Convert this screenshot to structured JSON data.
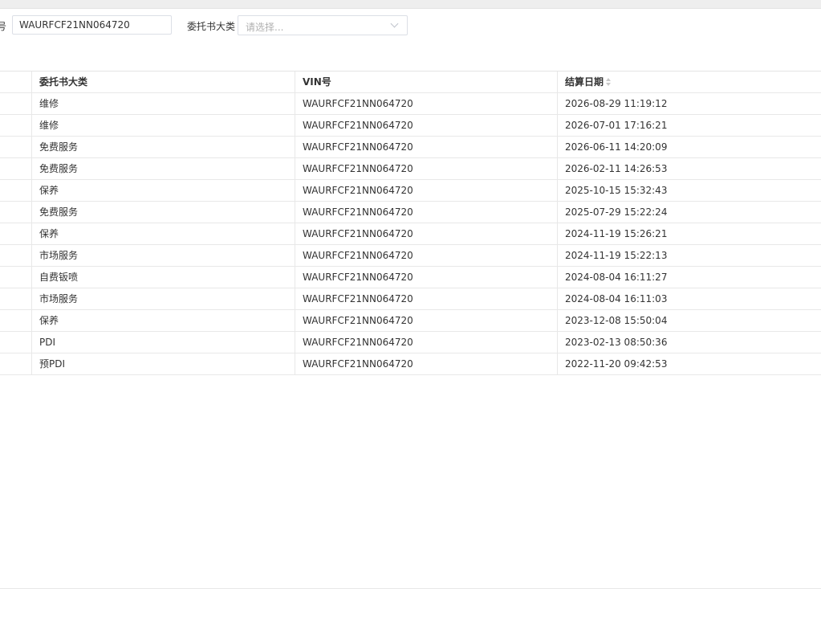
{
  "filters": {
    "vin_label": "号",
    "vin_value": "WAURFCF21NN064720",
    "category_label": "委托书大类",
    "category_placeholder": "请选择..."
  },
  "table": {
    "columns": [
      "",
      "委托书大类",
      "VIN号",
      "结算日期"
    ],
    "rows": [
      {
        "category": "维修",
        "vin": "WAURFCF21NN064720",
        "date": "2026-08-29 11:19:12"
      },
      {
        "category": "维修",
        "vin": "WAURFCF21NN064720",
        "date": "2026-07-01 17:16:21"
      },
      {
        "category": "免费服务",
        "vin": "WAURFCF21NN064720",
        "date": "2026-06-11 14:20:09"
      },
      {
        "category": "免费服务",
        "vin": "WAURFCF21NN064720",
        "date": "2026-02-11 14:26:53"
      },
      {
        "category": "保养",
        "vin": "WAURFCF21NN064720",
        "date": "2025-10-15 15:32:43"
      },
      {
        "category": "免费服务",
        "vin": "WAURFCF21NN064720",
        "date": "2025-07-29 15:22:24"
      },
      {
        "category": "保养",
        "vin": "WAURFCF21NN064720",
        "date": "2024-11-19 15:26:21"
      },
      {
        "category": "市场服务",
        "vin": "WAURFCF21NN064720",
        "date": "2024-11-19 15:22:13"
      },
      {
        "category": "自费钣喷",
        "vin": "WAURFCF21NN064720",
        "date": "2024-08-04 16:11:27"
      },
      {
        "category": "市场服务",
        "vin": "WAURFCF21NN064720",
        "date": "2024-08-04 16:11:03"
      },
      {
        "category": "保养",
        "vin": "WAURFCF21NN064720",
        "date": "2023-12-08 15:50:04"
      },
      {
        "category": "PDI",
        "vin": "WAURFCF21NN064720",
        "date": "2023-02-13 08:50:36"
      },
      {
        "category": "预PDI",
        "vin": "WAURFCF21NN064720",
        "date": "2022-11-20 09:42:53"
      }
    ]
  },
  "icons": {
    "sort": "sort-icon",
    "dropdown": "chevron-down-icon"
  },
  "colors": {
    "border": "#e8e8e8",
    "header_text": "#333333",
    "placeholder": "#b0b0b0"
  }
}
